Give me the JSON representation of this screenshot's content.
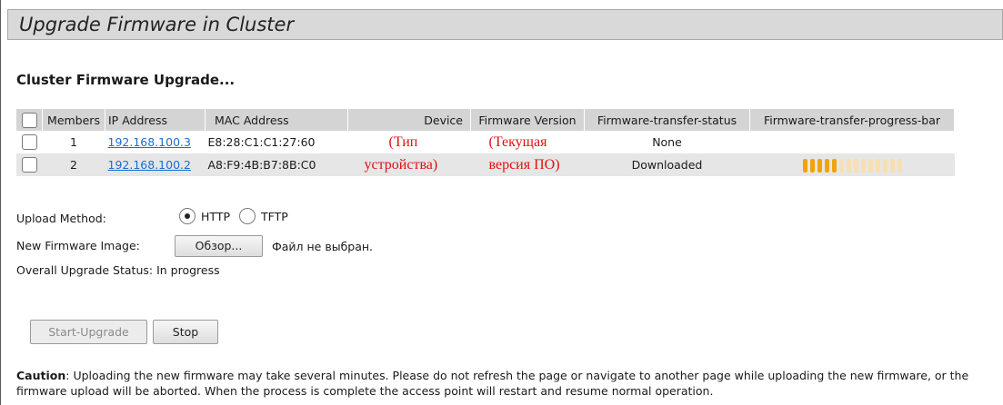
{
  "page": {
    "title": "Upgrade Firmware in Cluster",
    "section_title": "Cluster Firmware Upgrade..."
  },
  "table": {
    "headers": {
      "members": "Members",
      "ip": "IP Address",
      "mac": "MAC Address",
      "device": "Device",
      "fw_version": "Firmware Version",
      "transfer_status": "Firmware-transfer-status",
      "progress_bar": "Firmware-transfer-progress-bar"
    },
    "rows": [
      {
        "member": "1",
        "ip": "192.168.100.3",
        "mac": "E8:28:C1:C1:27:60",
        "device": "(Тип",
        "fw_version": "(Текущая",
        "status": "None"
      },
      {
        "member": "2",
        "ip": "192.168.100.2",
        "mac": "A8:F9:4B:B7:8B:C0",
        "device": "устройства)",
        "fw_version": "версия ПО)",
        "status": "Downloaded",
        "progress_fraction": 0.35
      }
    ]
  },
  "form": {
    "upload_method_label": "Upload Method:",
    "http_label": "HTTP",
    "tftp_label": "TFTP",
    "selected_method": "HTTP",
    "image_label": "New Firmware Image:",
    "browse_button": "Обзор...",
    "file_status": "Файл не выбран.",
    "overall_status": "Overall Upgrade Status: In progress"
  },
  "buttons": {
    "start": "Start-Upgrade",
    "stop": "Stop"
  },
  "caution": {
    "label": "Caution",
    "text": ": Uploading the new firmware may take several minutes. Please do not refresh the page or navigate to another page while uploading the new firmware, or the firmware upload will be aborted. When the process is complete the access point will restart and resume normal operation."
  },
  "colors": {
    "link": "#1a6fd0",
    "annotation_red": "#e01010",
    "progress_filled": "#f2a30c",
    "progress_empty": "#f7dfb0"
  }
}
